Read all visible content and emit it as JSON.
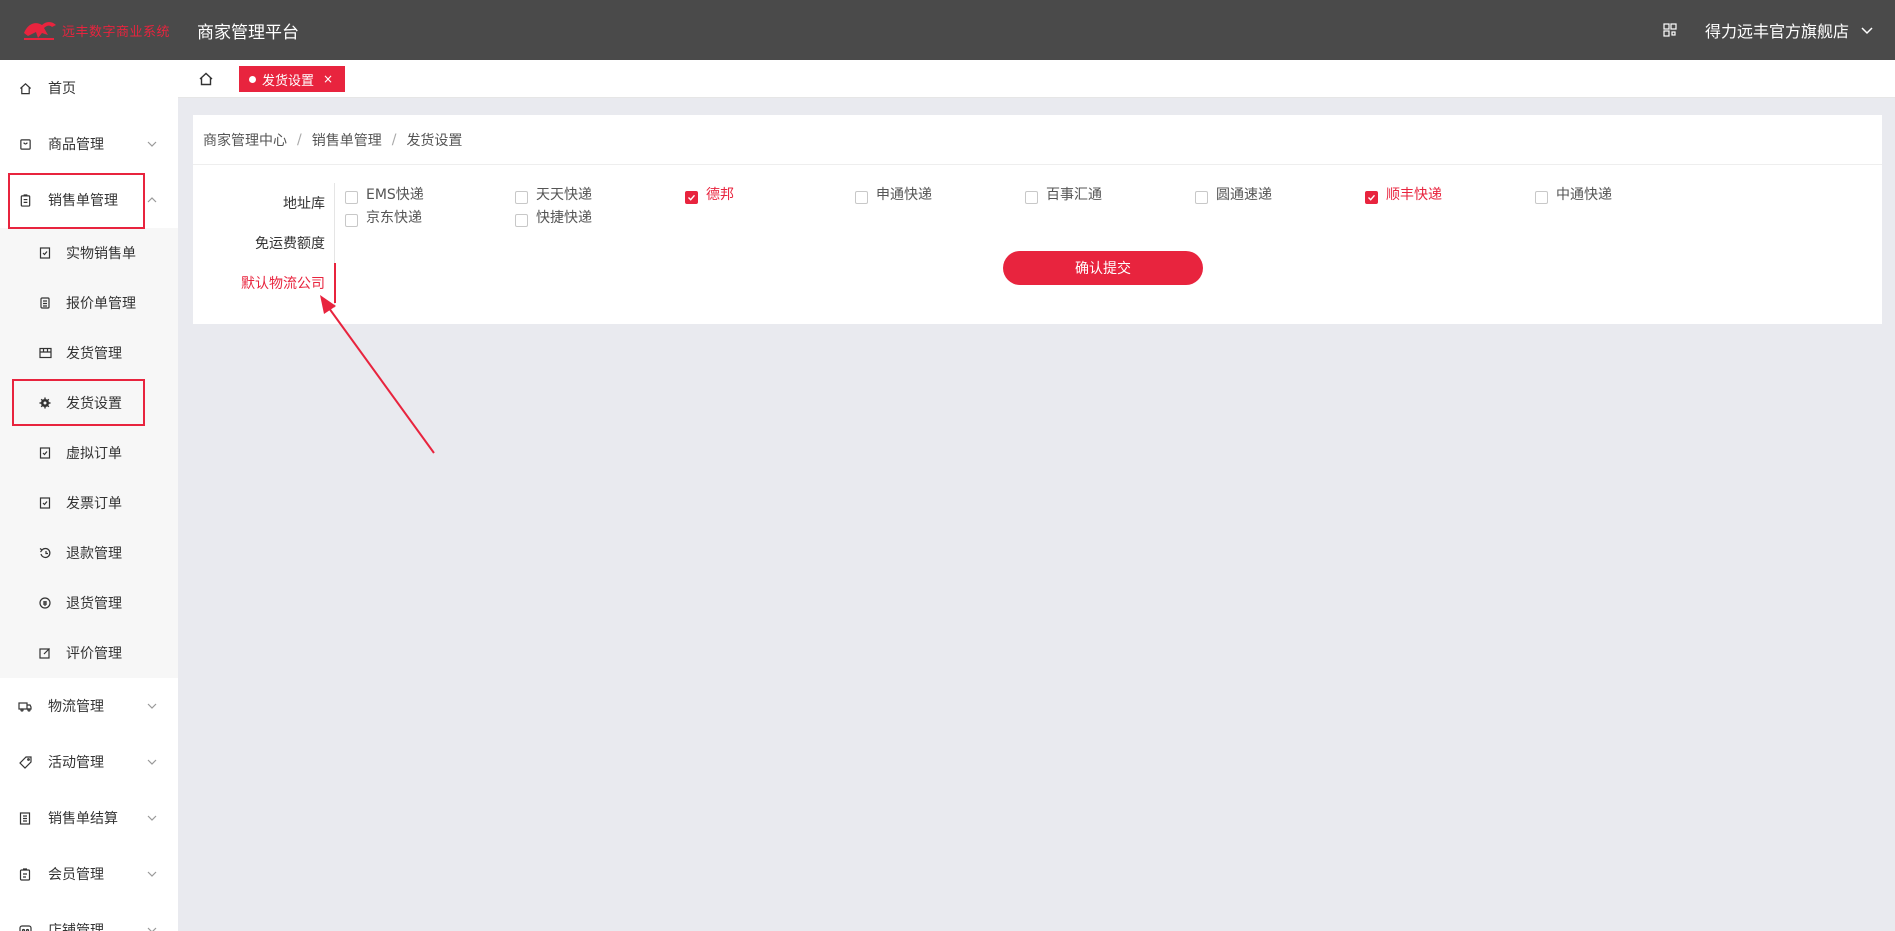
{
  "header": {
    "logo_text": "远丰数字商业系统",
    "platform_title": "商家管理平台",
    "store_name": "得力远丰官方旗舰店"
  },
  "sidebar": {
    "items": [
      {
        "label": "首页",
        "icon": "home-icon"
      },
      {
        "label": "商品管理",
        "icon": "goods-icon"
      },
      {
        "label": "销售单管理",
        "icon": "sales-order-icon"
      }
    ],
    "sub_items": [
      {
        "label": "实物销售单",
        "icon": "doc-check-icon"
      },
      {
        "label": "报价单管理",
        "icon": "doc-list-icon"
      },
      {
        "label": "发货管理",
        "icon": "box-icon"
      },
      {
        "label": "发货设置",
        "icon": "gear-icon"
      },
      {
        "label": "虚拟订单",
        "icon": "doc-check-icon"
      },
      {
        "label": "发票订单",
        "icon": "doc-check-icon"
      },
      {
        "label": "退款管理",
        "icon": "refund-icon"
      },
      {
        "label": "退货管理",
        "icon": "return-icon"
      },
      {
        "label": "评价管理",
        "icon": "edit-icon"
      }
    ],
    "items_after": [
      {
        "label": "物流管理",
        "icon": "truck-icon"
      },
      {
        "label": "活动管理",
        "icon": "tag-icon"
      },
      {
        "label": "销售单结算",
        "icon": "ledger-icon"
      },
      {
        "label": "会员管理",
        "icon": "member-icon"
      },
      {
        "label": "店铺管理",
        "icon": "shop-icon"
      }
    ]
  },
  "tabs": {
    "active_label": "发货设置",
    "close": "×"
  },
  "breadcrumb": [
    "商家管理中心",
    "销售单管理",
    "发货设置"
  ],
  "breadcrumb_sep": "/",
  "side_tabs": [
    {
      "label": "地址库",
      "active": false
    },
    {
      "label": "免运费额度",
      "active": false
    },
    {
      "label": "默认物流公司",
      "active": true
    }
  ],
  "couriers": [
    {
      "label": "EMS快递",
      "checked": false
    },
    {
      "label": "天天快递",
      "checked": false
    },
    {
      "label": "德邦",
      "checked": true
    },
    {
      "label": "申通快递",
      "checked": false
    },
    {
      "label": "百事汇通",
      "checked": false
    },
    {
      "label": "圆通速递",
      "checked": false
    },
    {
      "label": "顺丰快递",
      "checked": true
    },
    {
      "label": "中通快递",
      "checked": false
    },
    {
      "label": "京东快递",
      "checked": false
    },
    {
      "label": "快捷快递",
      "checked": false
    }
  ],
  "submit_label": "确认提交",
  "colors": {
    "accent": "#e8243e",
    "header_bg": "#4a4a4a",
    "page_bg": "#e9eaef"
  }
}
